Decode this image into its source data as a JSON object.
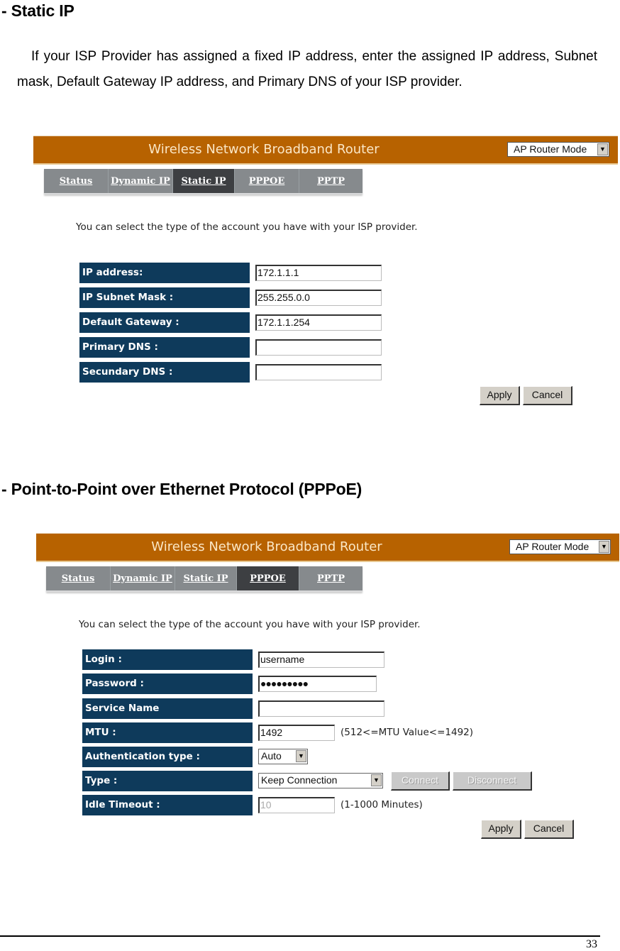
{
  "doc": {
    "section1_heading": "- Static IP",
    "section1_paragraph": "If your ISP Provider has assigned a fixed IP address, enter the assigned IP address, Subnet mask, Default Gateway IP address, and Primary DNS of your ISP provider.",
    "section2_heading": "- Point-to-Point over Ethernet Protocol (PPPoE)",
    "page_number": "33"
  },
  "router_ui": {
    "title": "Wireless Network Broadband Router",
    "mode_select": "AP Router Mode",
    "intro": "You can select the type of the account you have with your ISP provider.",
    "tabs": [
      "Status",
      "Dynamic IP",
      "Static IP",
      "PPPOE",
      "PPTP"
    ],
    "apply_label": "Apply",
    "cancel_label": "Cancel"
  },
  "static_ip": {
    "active_tab": "Static IP",
    "fields": [
      {
        "label": "IP address:",
        "value": "172.1.1.1"
      },
      {
        "label": "IP Subnet Mask :",
        "value": "255.255.0.0"
      },
      {
        "label": "Default Gateway :",
        "value": "172.1.1.254"
      },
      {
        "label": "Primary DNS :",
        "value": ""
      },
      {
        "label": "Secundary DNS :",
        "value": ""
      }
    ]
  },
  "pppoe": {
    "active_tab": "PPPOE",
    "login": {
      "label": "Login :",
      "value": "username"
    },
    "password": {
      "label": "Password :",
      "value": "●●●●●●●●●"
    },
    "service_name": {
      "label": "Service Name",
      "value": ""
    },
    "mtu": {
      "label": "MTU :",
      "value": "1492",
      "hint": "(512<=MTU Value<=1492)"
    },
    "auth_type": {
      "label": "Authentication type :",
      "value": "Auto"
    },
    "type": {
      "label": "Type :",
      "value": "Keep Connection",
      "connect_label": "Connect",
      "disconnect_label": "Disconnect"
    },
    "idle_timeout": {
      "label": "Idle Timeout :",
      "value": "10",
      "hint": "(1-1000 Minutes)"
    }
  }
}
